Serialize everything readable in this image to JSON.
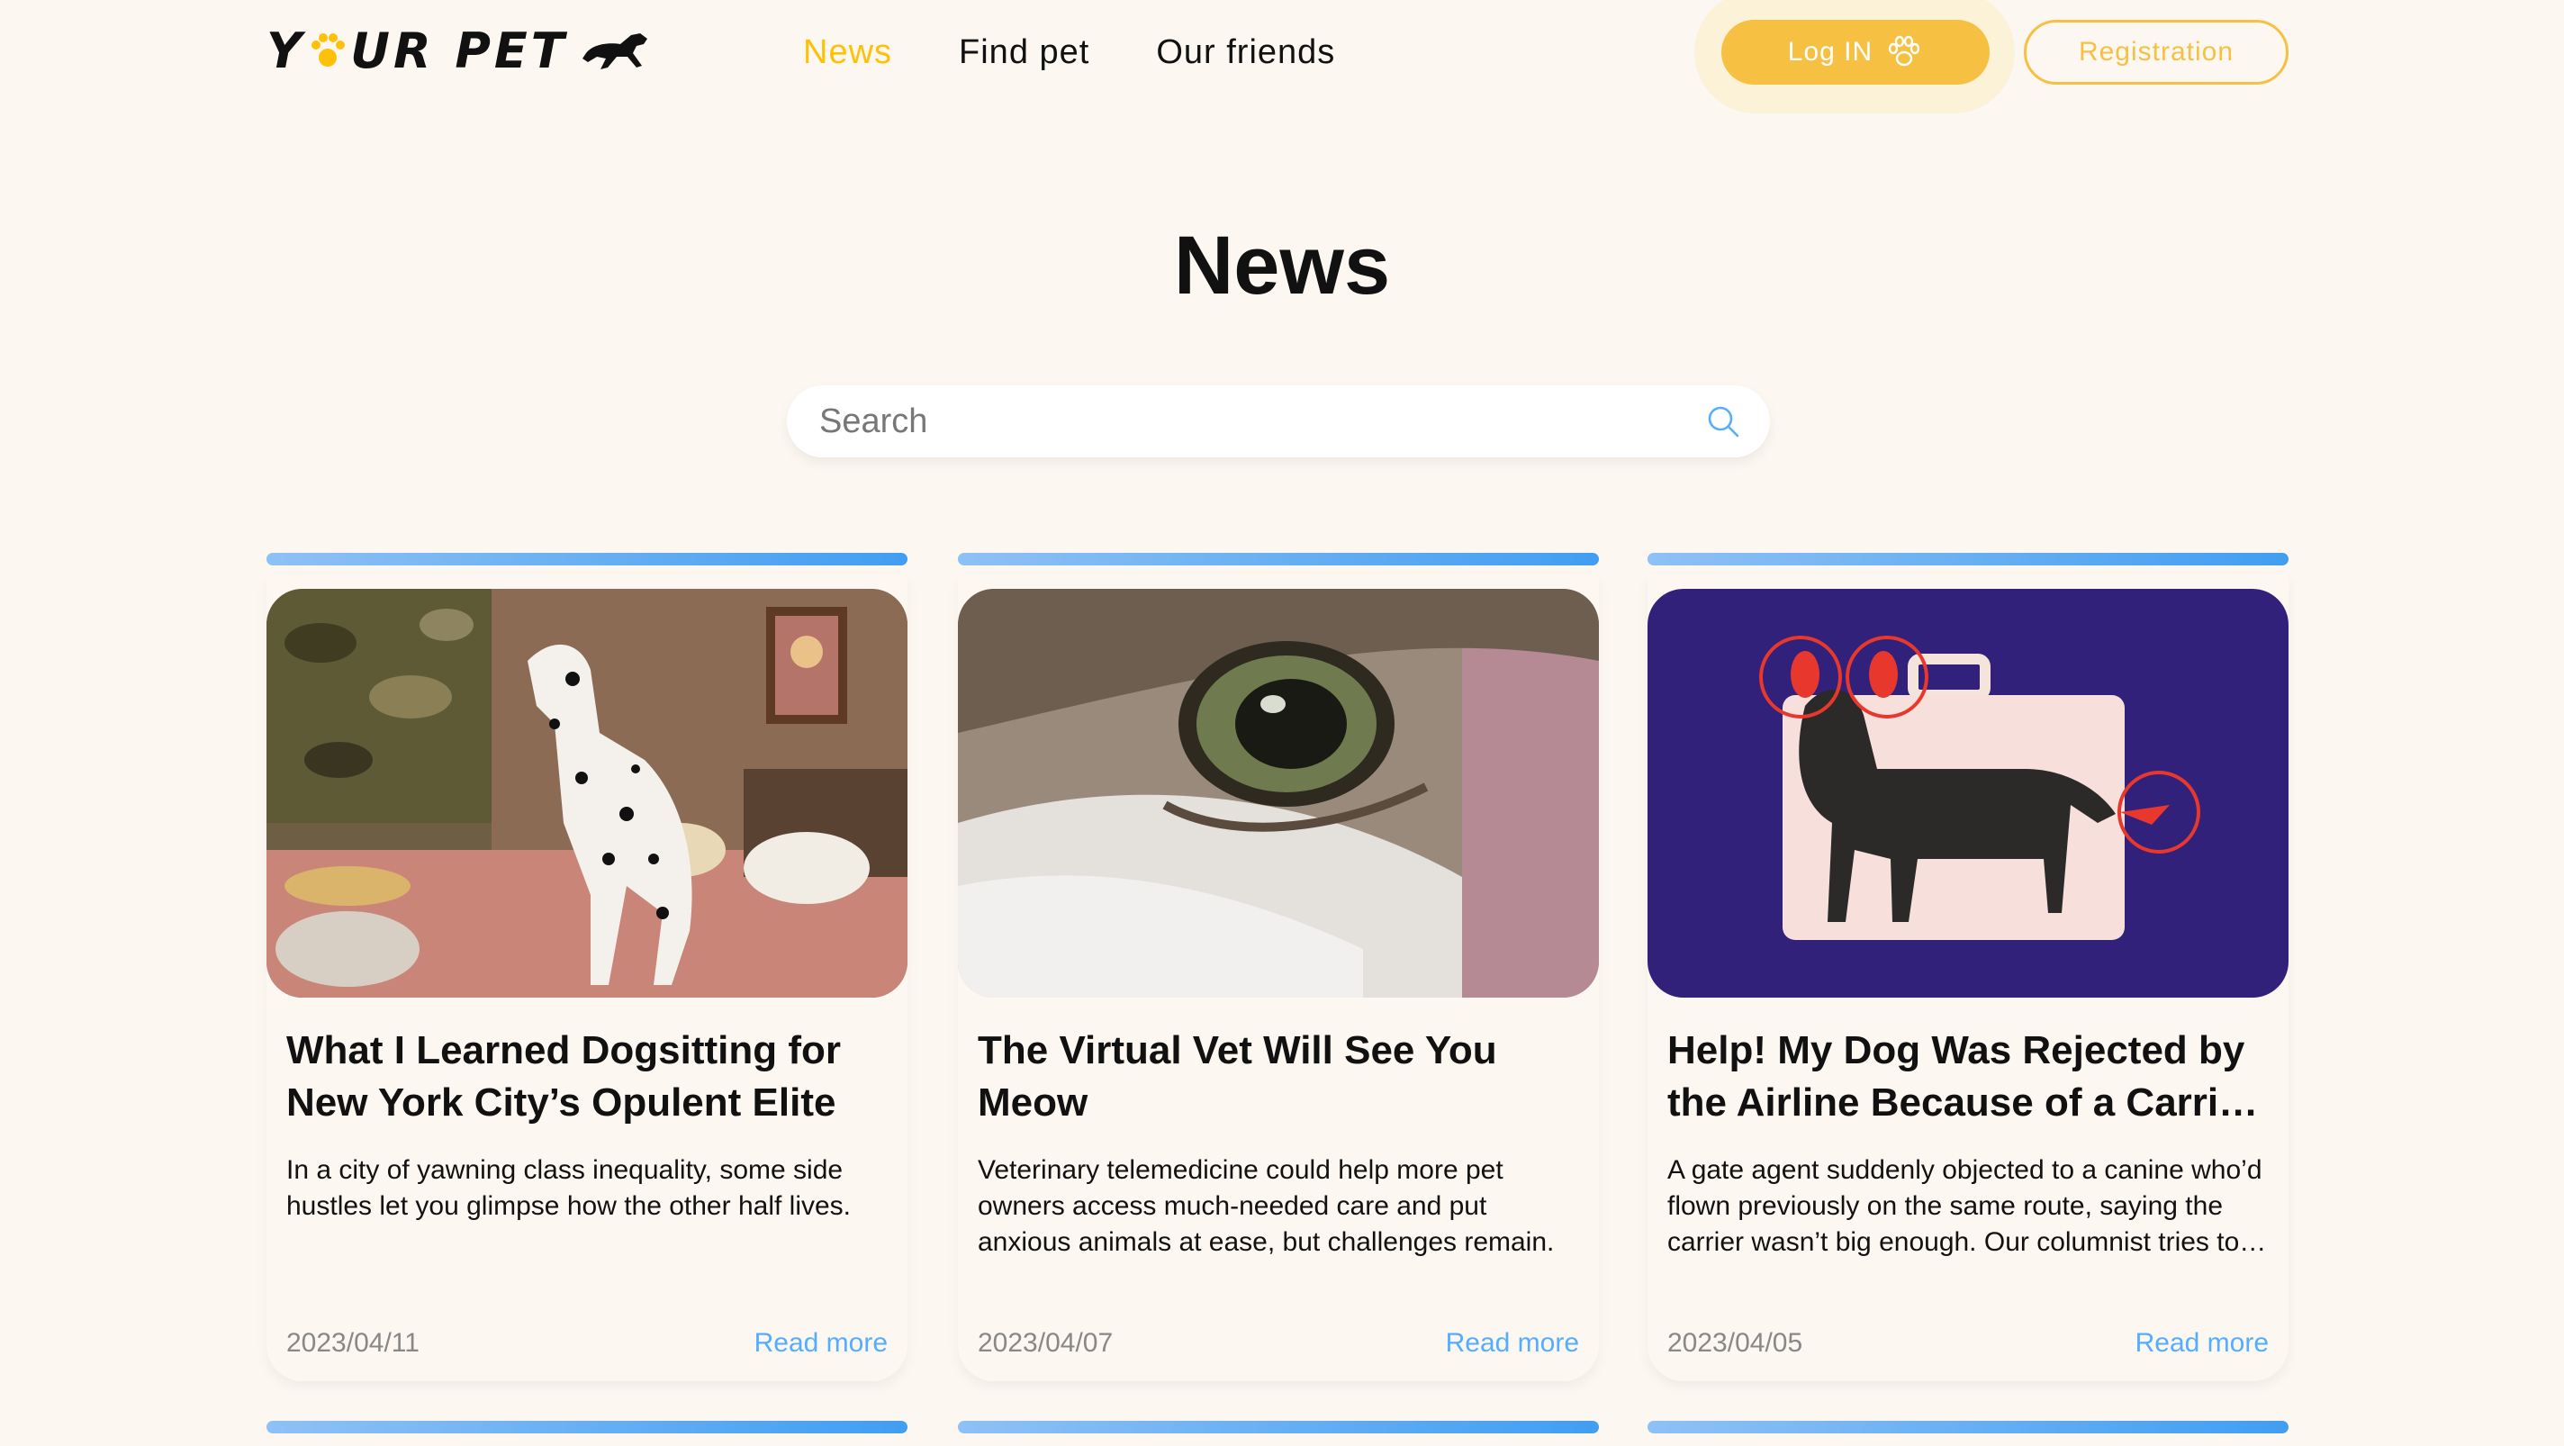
{
  "logo": {
    "text_before": "Y",
    "text_after": "UR PET"
  },
  "nav": [
    {
      "label": "News",
      "active": true
    },
    {
      "label": "Find pet",
      "active": false
    },
    {
      "label": "Our friends",
      "active": false
    }
  ],
  "auth": {
    "login_label": "Log IN",
    "register_label": "Registration"
  },
  "page": {
    "title": "News"
  },
  "search": {
    "placeholder": "Search",
    "value": ""
  },
  "colors": {
    "accent": "#FFC107",
    "link": "#54ADFF",
    "bar_start": "#8FC1F5",
    "bar_end": "#419EF1",
    "background": "#FDF7F2"
  },
  "cards": [
    {
      "image": "dalmatian-dog-on-bed-photo",
      "title": "What I Learned Dogsitting for New York City’s Opulent Elite",
      "text": "In a city of yawning class inequality, some side hustles let you glimpse how the other half lives.",
      "date": "2023/04/11",
      "read_more": "Read more"
    },
    {
      "image": "cat-eye-closeup-photo",
      "title": "The Virtual Vet Will See You Meow",
      "text": "Veterinary telemedicine could help more pet owners access much-needed care and put anxious animals at ease, but challenges remain.",
      "date": "2023/04/07",
      "read_more": "Read more"
    },
    {
      "image": "dog-and-carrier-illustration",
      "title": "Help! My Dog Was Rejected by the Airline Because of a Carrier That Was Too Small",
      "text": "A gate agent suddenly objected to a canine who’d flown previously on the same route, saying the carrier wasn’t big enough. Our columnist tries to help.",
      "date": "2023/04/05",
      "read_more": "Read more"
    }
  ]
}
